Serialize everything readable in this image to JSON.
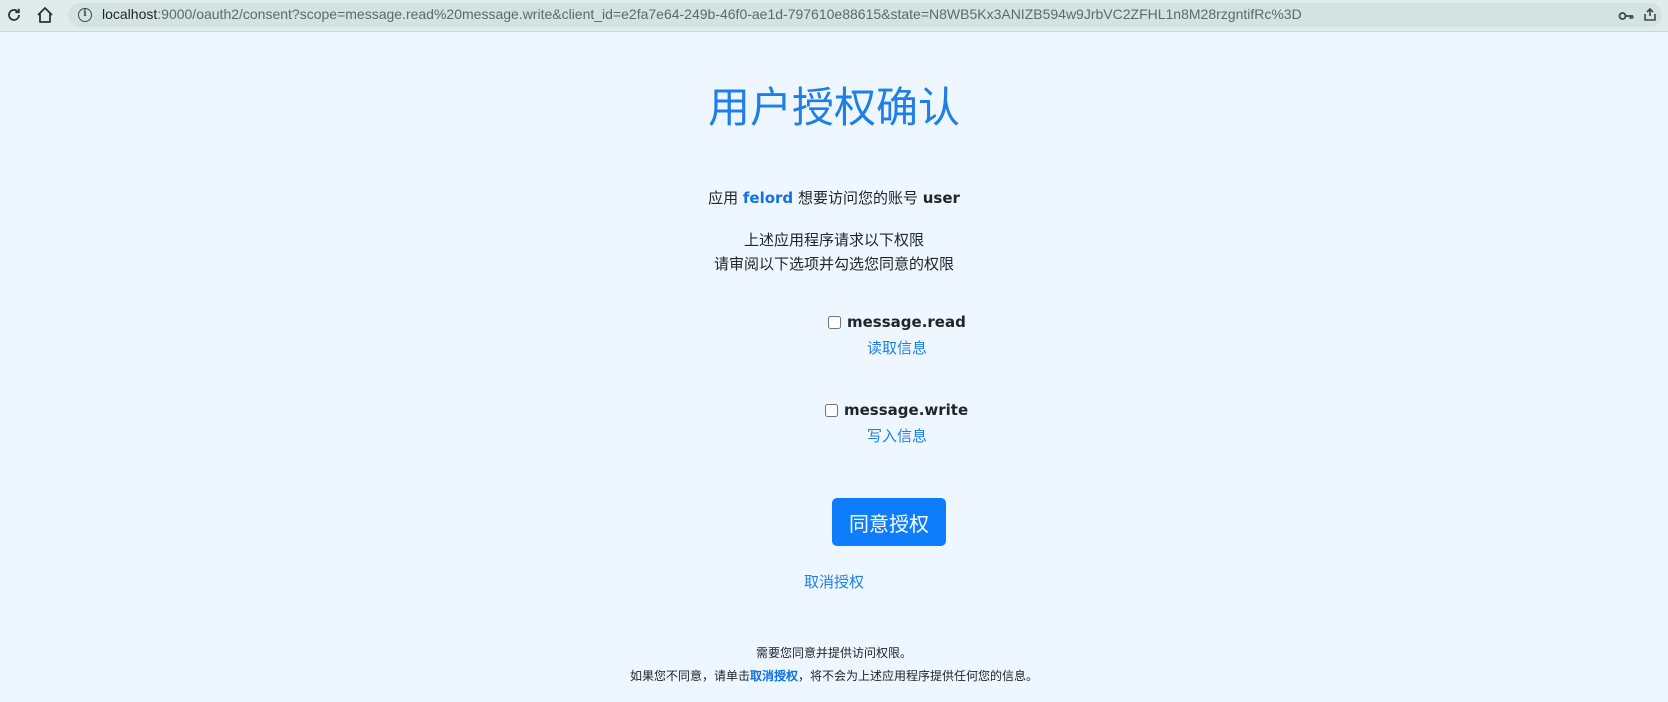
{
  "browser": {
    "url_host": "localhost",
    "url_rest": ":9000/oauth2/consent?scope=message.read%20message.write&client_id=e2fa7e64-249b-46f0-ae1d-797610e88615&state=N8WB5Kx3ANIZB594w9JrbVC2ZFHL1n8M28rzgntifRc%3D"
  },
  "page": {
    "title": "用户授权确认",
    "request_prefix": "应用",
    "app_name": "felord",
    "request_middle": "想要访问您的账号",
    "user_name": "user",
    "line1": "上述应用程序请求以下权限",
    "line2": "请审阅以下选项并勾选您同意的权限"
  },
  "scopes": [
    {
      "name": "message.read",
      "desc": "读取信息",
      "checked": false
    },
    {
      "name": "message.write",
      "desc": "写入信息",
      "checked": false
    }
  ],
  "actions": {
    "approve_label": "同意授权",
    "cancel_label": "取消授权"
  },
  "footer": {
    "line1": "需要您同意并提供访问权限。",
    "line2_prefix": "如果您不同意，请单击",
    "line2_link": "取消授权",
    "line2_suffix": "，将不会为上述应用程序提供任何您的信息。"
  },
  "colors": {
    "background": "#eef7ff",
    "accent": "#1e7fe6",
    "button": "#0d7dfb"
  }
}
